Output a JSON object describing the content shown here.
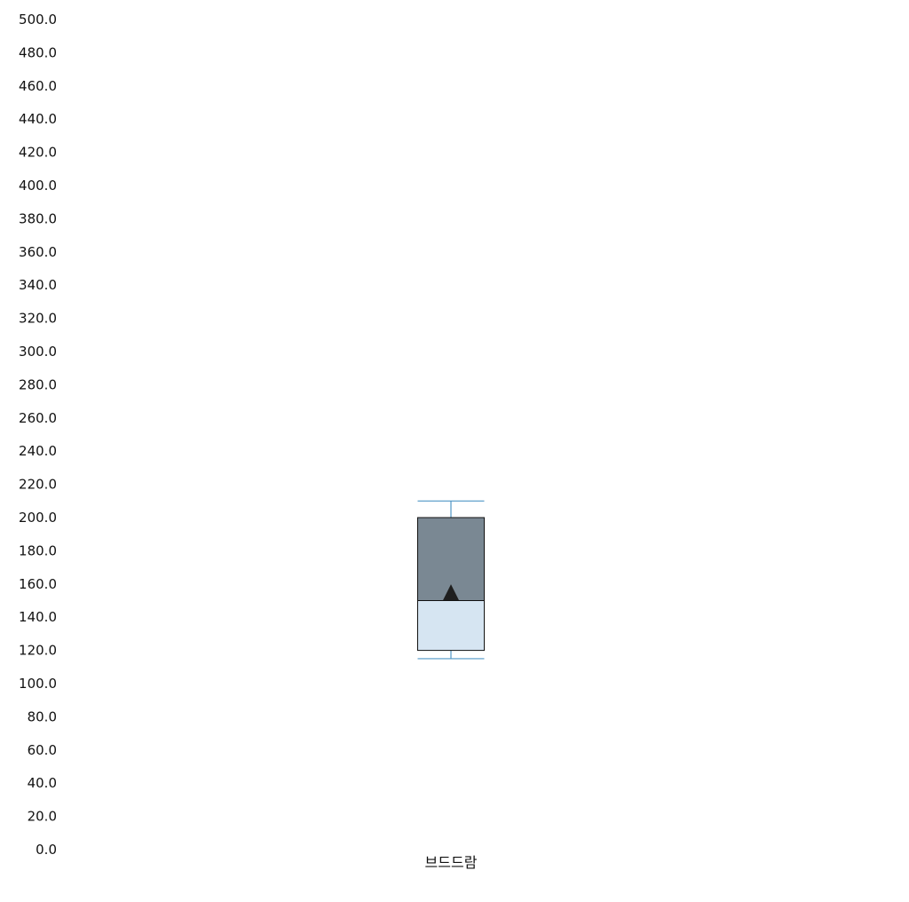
{
  "chart_data": {
    "type": "boxplot",
    "title": "",
    "xlabel": "",
    "ylabel": "",
    "ylim": [
      0,
      500
    ],
    "yticks": [
      0,
      20,
      40,
      60,
      80,
      100,
      120,
      140,
      160,
      180,
      200,
      220,
      240,
      260,
      280,
      300,
      320,
      340,
      360,
      380,
      400,
      420,
      440,
      460,
      480,
      500
    ],
    "ytick_labels": [
      "0.0",
      "20.0",
      "40.0",
      "60.0",
      "80.0",
      "100.0",
      "120.0",
      "140.0",
      "160.0",
      "180.0",
      "200.0",
      "220.0",
      "240.0",
      "260.0",
      "280.0",
      "300.0",
      "320.0",
      "340.0",
      "360.0",
      "380.0",
      "400.0",
      "420.0",
      "440.0",
      "460.0",
      "480.0",
      "500.0"
    ],
    "grid": false,
    "categories": [
      "브드드람"
    ],
    "boxes": [
      {
        "category": "브드드람",
        "whisker_low": 115,
        "q1": 120,
        "median": 150,
        "q3": 200,
        "whisker_high": 210,
        "mean": 155
      }
    ],
    "colors": {
      "upper_box": "#7a8893",
      "lower_box": "#d6e5f2",
      "box_edge": "#111111",
      "whisker": "#4f97c6",
      "mean_marker": "#1f1f1f"
    }
  }
}
